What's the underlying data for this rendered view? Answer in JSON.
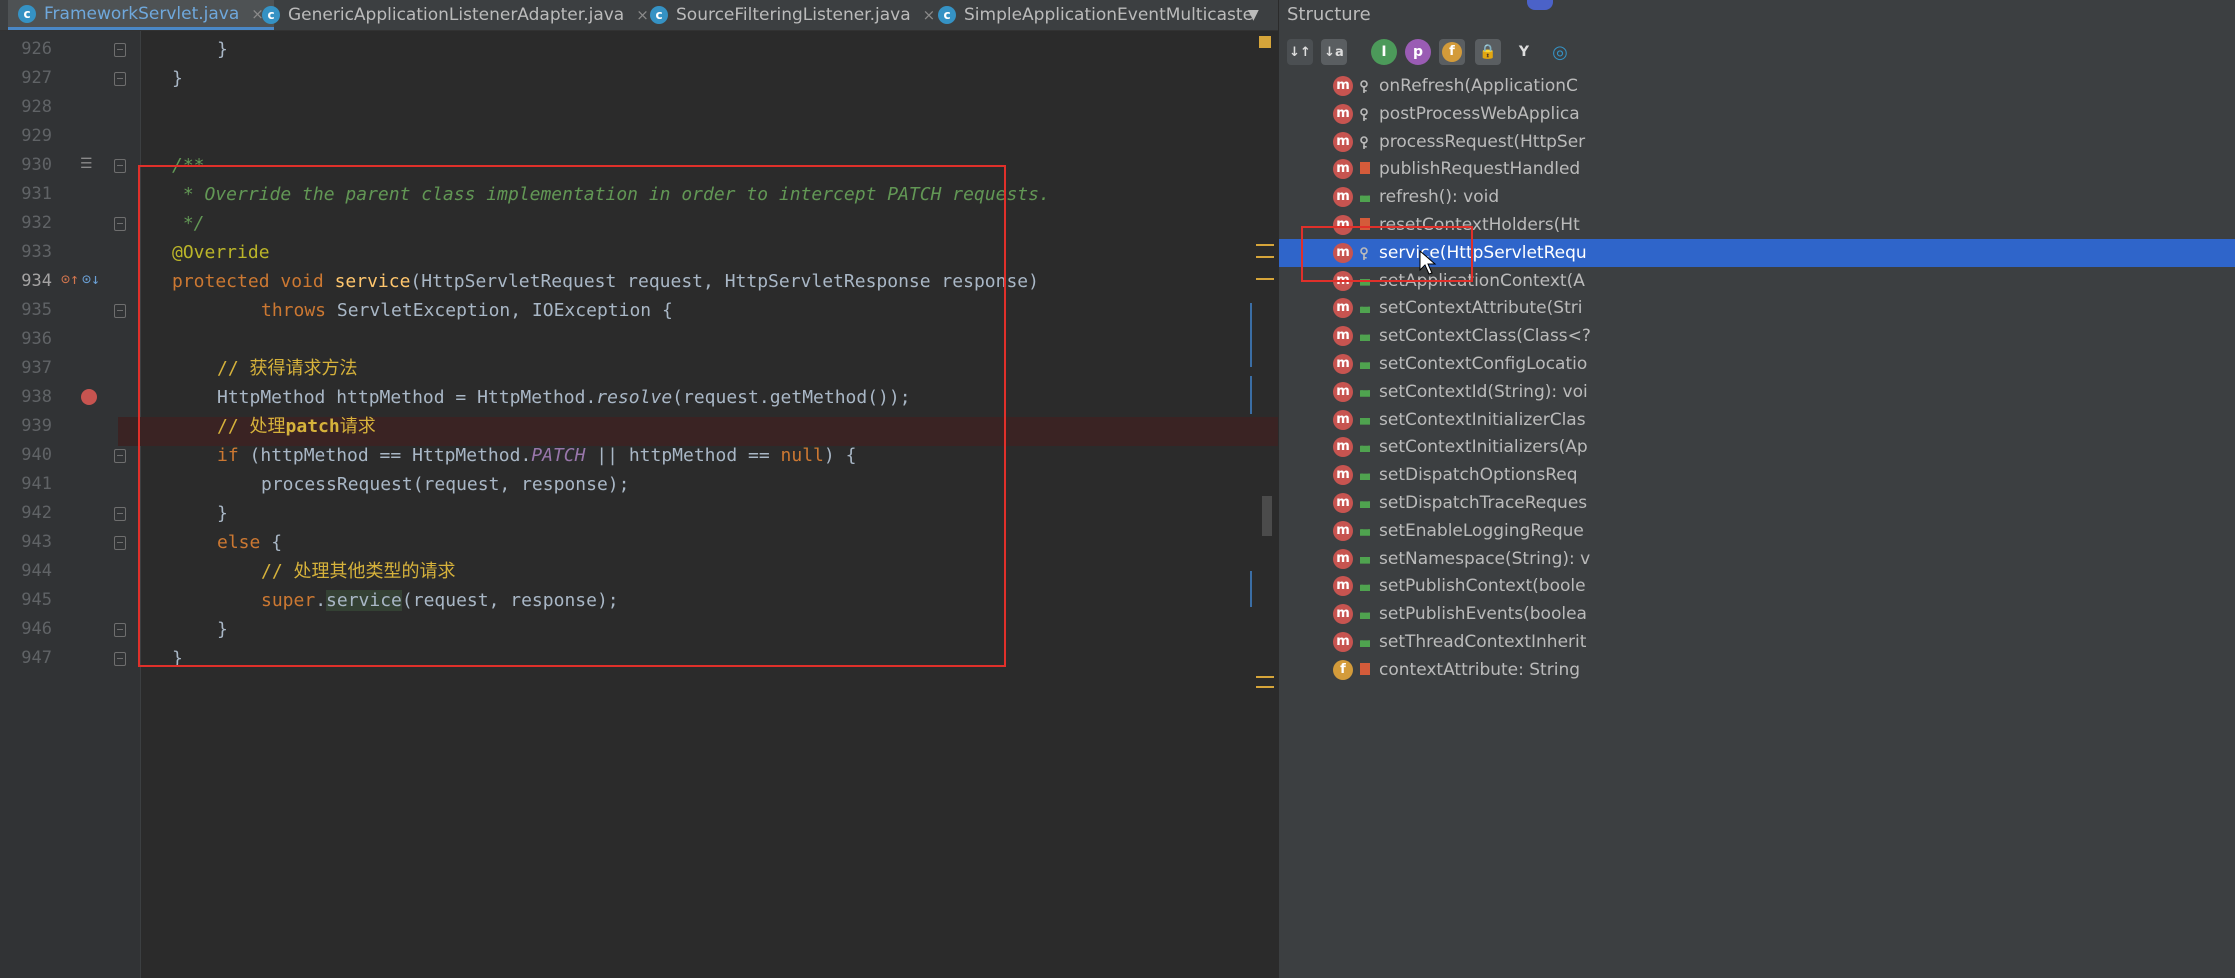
{
  "tabs": [
    {
      "label": "FrameworkServlet.java",
      "icon": "class-icon",
      "active": true,
      "closable": true
    },
    {
      "label": "GenericApplicationListenerAdapter.java",
      "icon": "class-icon",
      "active": false,
      "closable": true
    },
    {
      "label": "SourceFilteringListener.java",
      "icon": "class-icon",
      "active": false,
      "closable": true
    },
    {
      "label": "SimpleApplicationEventMulticaste",
      "icon": "class-icon",
      "active": false,
      "closable": false
    }
  ],
  "tab_close_glyph": "×",
  "tab_overflow_glyph": "▼",
  "editor": {
    "line_numbers": [
      "926",
      "927",
      "928",
      "929",
      "930",
      "931",
      "932",
      "933",
      "934",
      "935",
      "936",
      "937",
      "938",
      "939",
      "940",
      "941",
      "942",
      "943",
      "944",
      "945",
      "946",
      "947"
    ],
    "code": {
      "l926": "}",
      "l927": "}",
      "l930": "/**",
      "l931": " * Override the parent class implementation in order to intercept PATCH requests.",
      "l932": " */",
      "l933": "@Override",
      "l934_kw": "protected void ",
      "l934_fn": "service",
      "l934_rest": "(HttpServletRequest request, HttpServletResponse response)",
      "l935_kw": "throws ",
      "l935_rest": "ServletException, IOException {",
      "l937": "// 获得请求方法",
      "l938_a": "HttpMethod httpMethod = HttpMethod.",
      "l938_it": "resolve",
      "l938_b": "(request.getMethod());",
      "l939_a": "// 处理",
      "l939_b": "patch",
      "l939_c": "请求",
      "l940_kw": "if ",
      "l940_a": "(httpMethod == HttpMethod.",
      "l940_fld": "PATCH",
      "l940_b": " || httpMethod == ",
      "l940_null": "null",
      "l940_c": ") {",
      "l941": "processRequest(request, response);",
      "l942": "}",
      "l943_kw": "else ",
      "l943_b": "{",
      "l944": "// 处理其他类型的请求",
      "l945_kw": "super",
      "l945_dot": ".",
      "l945_svc": "service",
      "l945_rest": "(request, response);",
      "l946": "}",
      "l947": "}"
    }
  },
  "structure": {
    "title": "Structure",
    "toolbar": [
      {
        "name": "sort-by-visibility-icon",
        "glyph": "↓↑"
      },
      {
        "name": "sort-alphabetically-icon",
        "glyph": "↓a"
      },
      {
        "name": "show-inherited-icon",
        "glyph": "I"
      },
      {
        "name": "show-properties-icon",
        "glyph": "p"
      },
      {
        "name": "show-fields-icon",
        "glyph": "f"
      },
      {
        "name": "show-non-public-icon",
        "glyph": "🔒"
      },
      {
        "name": "show-lambdas-icon",
        "glyph": "Y"
      },
      {
        "name": "autoscroll-icon",
        "glyph": "◎"
      }
    ],
    "items": [
      {
        "icon": "m",
        "visibility": "protected",
        "label": "onRefresh(ApplicationC"
      },
      {
        "icon": "m",
        "visibility": "protected",
        "label": "postProcessWebApplica"
      },
      {
        "icon": "m",
        "visibility": "protected",
        "label": "processRequest(HttpSer"
      },
      {
        "icon": "m",
        "visibility": "private",
        "label": "publishRequestHandled"
      },
      {
        "icon": "m",
        "visibility": "public",
        "label": "refresh(): void"
      },
      {
        "icon": "m",
        "visibility": "private",
        "label": "resetContextHolders(Ht"
      },
      {
        "icon": "m",
        "visibility": "protected",
        "label": "service(HttpServletRequ",
        "selected": true
      },
      {
        "icon": "m",
        "visibility": "public",
        "label": "setApplicationContext(A"
      },
      {
        "icon": "m",
        "visibility": "public",
        "label": "setContextAttribute(Stri"
      },
      {
        "icon": "m",
        "visibility": "public",
        "label": "setContextClass(Class<?"
      },
      {
        "icon": "m",
        "visibility": "public",
        "label": "setContextConfigLocatio"
      },
      {
        "icon": "m",
        "visibility": "public",
        "label": "setContextId(String): voi"
      },
      {
        "icon": "m",
        "visibility": "public",
        "label": "setContextInitializerClas"
      },
      {
        "icon": "m",
        "visibility": "public",
        "label": "setContextInitializers(Ap"
      },
      {
        "icon": "m",
        "visibility": "public",
        "label": "setDispatchOptionsReq"
      },
      {
        "icon": "m",
        "visibility": "public",
        "label": "setDispatchTraceReques"
      },
      {
        "icon": "m",
        "visibility": "public",
        "label": "setEnableLoggingReque"
      },
      {
        "icon": "m",
        "visibility": "public",
        "label": "setNamespace(String): v"
      },
      {
        "icon": "m",
        "visibility": "public",
        "label": "setPublishContext(boole"
      },
      {
        "icon": "m",
        "visibility": "public",
        "label": "setPublishEvents(boolea"
      },
      {
        "icon": "m",
        "visibility": "public",
        "label": "setThreadContextInherit"
      },
      {
        "icon": "f",
        "visibility": "private",
        "label": "contextAttribute: String"
      }
    ]
  },
  "colors": {
    "keyword": "#cc7832",
    "annotation": "#bbb529",
    "method_declaration": "#ffc66d",
    "javadoc": "#629755",
    "comment": "#d6b23b",
    "static_field": "#9876aa",
    "highlight_box": "#e0302a",
    "selection": "#2f65ca"
  }
}
